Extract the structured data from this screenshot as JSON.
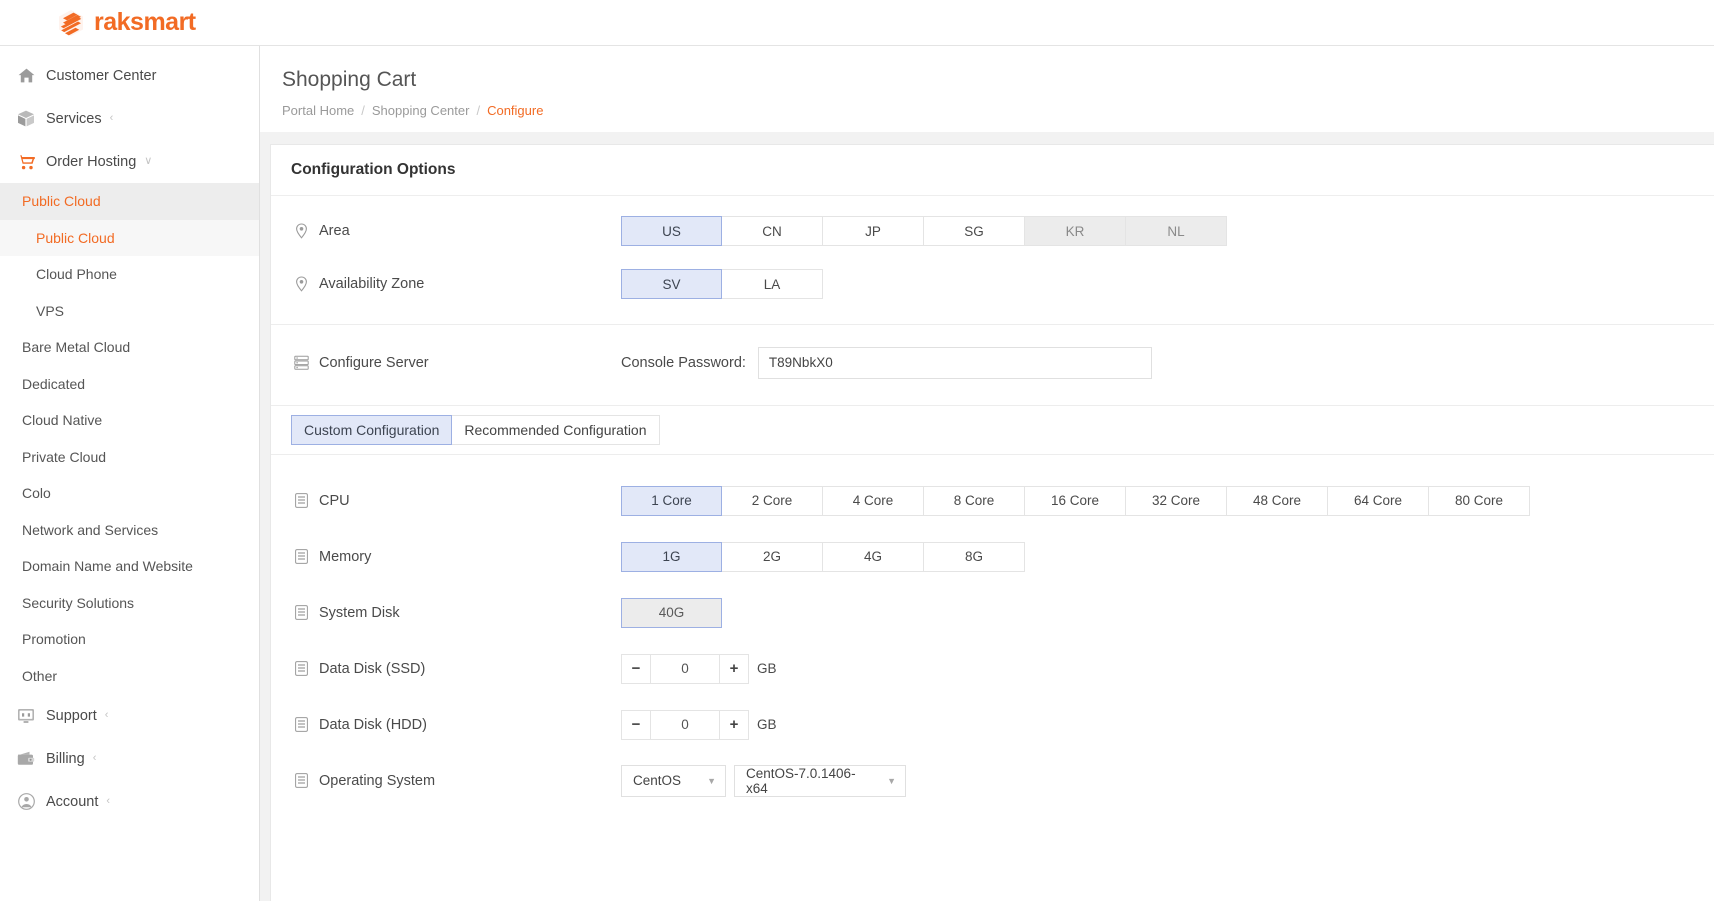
{
  "brand": {
    "name": "raksmart",
    "color": "#f26b24",
    "logo_icon": "raksmart-logo-icon"
  },
  "sidebar": {
    "items": [
      {
        "label": "Customer Center",
        "icon": "home-icon",
        "caret": ""
      },
      {
        "label": "Services",
        "icon": "box-icon",
        "caret": "‹"
      },
      {
        "label": "Order Hosting",
        "icon": "cart-icon",
        "caret": "∨"
      }
    ],
    "sub_items": [
      {
        "label": "Public Cloud",
        "active": true
      },
      {
        "label": "Public Cloud",
        "active": true,
        "nested": true
      },
      {
        "label": "Cloud Phone",
        "nested": true
      },
      {
        "label": "VPS",
        "nested": true
      },
      {
        "label": "Bare Metal Cloud"
      },
      {
        "label": "Dedicated"
      },
      {
        "label": "Cloud Native"
      },
      {
        "label": "Private Cloud"
      },
      {
        "label": "Colo"
      },
      {
        "label": "Network and Services"
      },
      {
        "label": "Domain Name and Website"
      },
      {
        "label": "Security Solutions"
      },
      {
        "label": "Promotion"
      },
      {
        "label": "Other"
      }
    ],
    "footer_items": [
      {
        "label": "Support",
        "icon": "support-monitor-icon",
        "caret": "‹"
      },
      {
        "label": "Billing",
        "icon": "wallet-icon",
        "caret": "‹"
      },
      {
        "label": "Account",
        "icon": "user-circle-icon",
        "caret": "‹"
      }
    ]
  },
  "header": {
    "title": "Shopping Cart",
    "breadcrumb": [
      {
        "label": "Portal Home",
        "current": false
      },
      {
        "label": "Shopping Center",
        "current": false
      },
      {
        "label": "Configure",
        "current": true
      }
    ],
    "separator": "/"
  },
  "panel": {
    "title": "Configuration Options"
  },
  "area": {
    "label": "Area",
    "icon": "location-pin-icon",
    "options": [
      {
        "label": "US",
        "state": "selected"
      },
      {
        "label": "CN",
        "state": "normal"
      },
      {
        "label": "JP",
        "state": "normal"
      },
      {
        "label": "SG",
        "state": "normal"
      },
      {
        "label": "KR",
        "state": "disabled"
      },
      {
        "label": "NL",
        "state": "disabled"
      }
    ]
  },
  "availability_zone": {
    "label": "Availability Zone",
    "icon": "location-pin-icon",
    "options": [
      {
        "label": "SV",
        "state": "selected"
      },
      {
        "label": "LA",
        "state": "normal"
      }
    ]
  },
  "configure_server": {
    "label": "Configure Server",
    "icon": "server-icon",
    "password_label": "Console Password:",
    "password_value": "T89NbkX0",
    "password_placeholder": "Console Password"
  },
  "tabs": [
    {
      "label": "Custom Configuration",
      "active": true
    },
    {
      "label": "Recommended Configuration",
      "active": false
    }
  ],
  "cpu": {
    "label": "CPU",
    "icon": "list-doc-icon",
    "options": [
      {
        "label": "1 Core",
        "state": "selected"
      },
      {
        "label": "2 Core",
        "state": "normal"
      },
      {
        "label": "4 Core",
        "state": "normal"
      },
      {
        "label": "8 Core",
        "state": "normal"
      },
      {
        "label": "16 Core",
        "state": "normal"
      },
      {
        "label": "32 Core",
        "state": "normal"
      },
      {
        "label": "48 Core",
        "state": "normal"
      },
      {
        "label": "64 Core",
        "state": "normal"
      },
      {
        "label": "80 Core",
        "state": "normal"
      }
    ]
  },
  "memory": {
    "label": "Memory",
    "icon": "list-doc-icon",
    "options": [
      {
        "label": "1G",
        "state": "selected"
      },
      {
        "label": "2G",
        "state": "normal"
      },
      {
        "label": "4G",
        "state": "normal"
      },
      {
        "label": "8G",
        "state": "normal"
      }
    ]
  },
  "system_disk": {
    "label": "System Disk",
    "icon": "list-doc-icon",
    "options": [
      {
        "label": "40G",
        "state": "selected-flat"
      }
    ]
  },
  "data_disk_ssd": {
    "label": "Data Disk (SSD)",
    "icon": "list-doc-icon",
    "minus": "−",
    "plus": "+",
    "value": "0",
    "unit": "GB"
  },
  "data_disk_hdd": {
    "label": "Data Disk (HDD)",
    "icon": "list-doc-icon",
    "minus": "−",
    "plus": "+",
    "value": "0",
    "unit": "GB"
  },
  "operating_system": {
    "label": "Operating System",
    "icon": "list-doc-icon",
    "os_value": "CentOS",
    "version_value": "CentOS-7.0.1406-x64",
    "chevron": "▼"
  }
}
